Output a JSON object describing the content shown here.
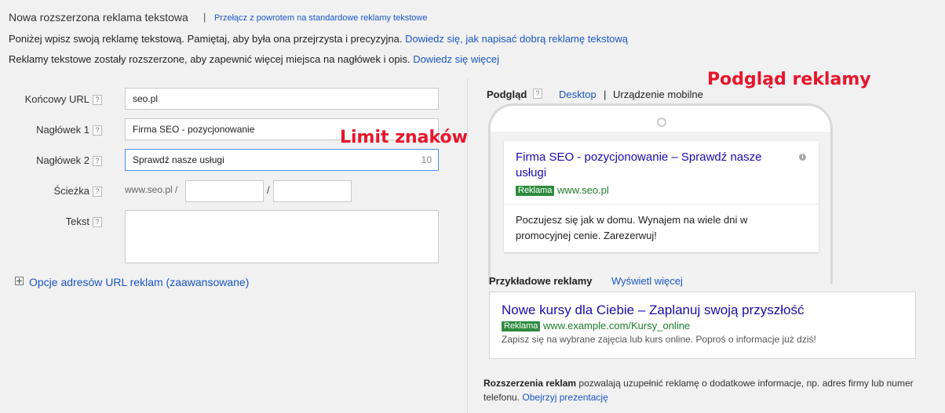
{
  "header": {
    "title": "Nowa rozszerzona reklama tekstowa",
    "separator": "|",
    "switch_link": "Przełącz z powrotem na standardowe reklamy tekstowe",
    "line1_text": "Poniżej wpisz swoją reklamę tekstową. Pamiętaj, aby była ona przejrzysta i precyzyjna.",
    "line1_link": "Dowiedz się, jak napisać dobrą reklamę tekstową",
    "line2_text": "Reklamy tekstowe zostały rozszerzone, aby zapewnić więcej miejsca na nagłówek i opis.",
    "line2_link": "Dowiedz się więcej"
  },
  "form": {
    "help_glyph": "?",
    "final_url": {
      "label": "Końcowy URL",
      "value": "seo.pl"
    },
    "headline1": {
      "label": "Nagłówek 1",
      "value": "Firma SEO - pozycjonowanie"
    },
    "headline2": {
      "label": "Nagłówek 2",
      "value": "Sprawdź nasze usługi",
      "remaining": "10"
    },
    "path": {
      "label": "Ścieżka",
      "prefix": "www.seo.pl /",
      "slash": "/",
      "path1": "",
      "path2": ""
    },
    "text": {
      "label": "Tekst",
      "value": ""
    },
    "advanced_link": "Opcje adresów URL reklam (zaawansowane)"
  },
  "annotations": {
    "char_limit": "Limit znaków",
    "ad_preview": "Podgląd reklamy"
  },
  "preview": {
    "label": "Podgląd",
    "desktop": "Desktop",
    "separator": "|",
    "mobile": "Urządzenie mobilne",
    "mobile_ad": {
      "title": "Firma SEO - pozycjonowanie – Sprawdź nasze usługi",
      "badge": "Reklama",
      "url": "www.seo.pl",
      "info_glyph": "i",
      "description": "Poczujesz się jak w domu. Wynajem na wiele dni w promocyjnej cenie. Zarezerwuj!"
    }
  },
  "examples": {
    "label": "Przykładowe reklamy",
    "show_more": "Wyświetl więcej",
    "ad": {
      "title": "Nowe kursy dla Ciebie – Zaplanuj swoją przyszłość",
      "badge": "Reklama",
      "url": "www.example.com/Kursy_online",
      "description": "Zapisz się na wybrane zajęcia lub kurs online. Poproś o informacje już dziś!"
    }
  },
  "extensions": {
    "bold": "Rozszerzenia reklam",
    "text": "pozwalają uzupełnić reklamę o dodatkowe informacje, np. adres firmy lub numer telefonu.",
    "link": "Obejrzyj prezentację"
  },
  "colors": {
    "link": "#1a56c9",
    "ad_title": "#1a0dab",
    "ad_url": "#1e7c2b",
    "badge": "#2e8b3e",
    "annotation": "#e8152b",
    "focus_border": "#4d90fe"
  }
}
